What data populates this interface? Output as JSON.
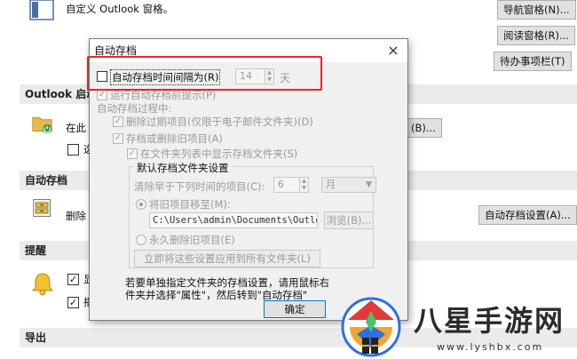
{
  "background": {
    "nav_text": "自定义 Outlook 窗格。",
    "nav_buttons": [
      "导航窗格(N)...",
      "阅读窗格(R)...",
      "待办事项栏(T)"
    ],
    "sections": {
      "outlook_start": "Outlook 启动",
      "autoarchive": "自动存档",
      "reminders": "提醒",
      "export": "导出"
    },
    "start_text": "在此",
    "start_browse": "(B)...",
    "start_checkbox": "选",
    "autoarchive_text": "删除",
    "autoarchive_button": "自动存档设置(A)...",
    "reminder_items": [
      "显",
      "播"
    ]
  },
  "dialog": {
    "title": "自动存档",
    "close": "×",
    "run_interval_label": "自动存档时间间隔为(R)",
    "interval_value": "14",
    "interval_unit": "天",
    "prompt_label": "运行自动存档前提示(P)",
    "during_label": "自动存档过程中:",
    "delete_expired_label": "删除过期项目(仅限于电子邮件文件夹)(D)",
    "archive_or_delete_label": "存档或删除旧项目(A)",
    "show_folder_label": "在文件夹列表中显示存档文件夹(S)",
    "defaults_group": "默认存档文件夹设置",
    "clean_older_label": "清除早于下列时间的项目(C):",
    "clean_value": "6",
    "clean_unit": "月",
    "move_to_label": "将旧项目移至(M):",
    "path": "C:\\Users\\admin\\Documents\\Outloo",
    "browse_button": "浏览(B)...",
    "permanently_delete_label": "永久删除旧项目(E)",
    "apply_all_button": "立即将这些设置应用到所有文件夹(L)",
    "note_line1": "若要单独指定文件夹的存档设置，请用鼠标右",
    "note_line2": "件夹并选择\"属性\"，然后转到\"自动存档\"",
    "ok_button": "确定"
  },
  "watermark": {
    "site_name": "八星手游网",
    "url": "www.lyshbx.com"
  },
  "colors": {
    "highlight_box": "#e8242a",
    "accent": "#0078d7"
  }
}
